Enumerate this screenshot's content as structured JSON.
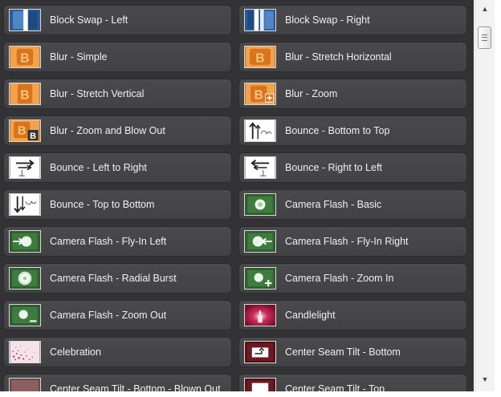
{
  "items": [
    {
      "label": "Block Swap - Left",
      "icon": "block-swap-left-icon"
    },
    {
      "label": "Block Swap - Right",
      "icon": "block-swap-right-icon"
    },
    {
      "label": "Blur - Simple",
      "icon": "blur-simple-icon"
    },
    {
      "label": "Blur - Stretch Horizontal",
      "icon": "blur-stretch-horizontal-icon"
    },
    {
      "label": "Blur - Stretch Vertical",
      "icon": "blur-stretch-vertical-icon"
    },
    {
      "label": "Blur - Zoom",
      "icon": "blur-zoom-icon"
    },
    {
      "label": "Blur - Zoom and Blow Out",
      "icon": "blur-zoom-blow-out-icon"
    },
    {
      "label": "Bounce - Bottom to Top",
      "icon": "bounce-bottom-to-top-icon"
    },
    {
      "label": "Bounce - Left to Right",
      "icon": "bounce-left-to-right-icon"
    },
    {
      "label": "Bounce - Right to Left",
      "icon": "bounce-right-to-left-icon"
    },
    {
      "label": "Bounce - Top to Bottom",
      "icon": "bounce-top-to-bottom-icon"
    },
    {
      "label": "Camera Flash - Basic",
      "icon": "camera-flash-basic-icon"
    },
    {
      "label": "Camera Flash - Fly-In Left",
      "icon": "camera-flash-fly-in-left-icon"
    },
    {
      "label": "Camera Flash - Fly-In Right",
      "icon": "camera-flash-fly-in-right-icon"
    },
    {
      "label": "Camera Flash - Radial Burst",
      "icon": "camera-flash-radial-burst-icon"
    },
    {
      "label": "Camera Flash - Zoom In",
      "icon": "camera-flash-zoom-in-icon"
    },
    {
      "label": "Camera Flash - Zoom Out",
      "icon": "camera-flash-zoom-out-icon"
    },
    {
      "label": "Candlelight",
      "icon": "candlelight-icon"
    },
    {
      "label": "Celebration",
      "icon": "celebration-icon"
    },
    {
      "label": "Center Seam Tilt - Bottom",
      "icon": "center-seam-tilt-bottom-icon"
    },
    {
      "label": "Center Seam Tilt - Bottom - Blown Out",
      "icon": "center-seam-tilt-bottom-blown-out-icon"
    },
    {
      "label": "Center Seam Tilt - Top",
      "icon": "center-seam-tilt-top-icon"
    }
  ],
  "colors": {
    "panel_bg": "#333335",
    "tile_bg": "#464649",
    "label_text": "#f0f0f0",
    "blur_orange": "#e08a2a",
    "flash_green": "#2e5e2e",
    "block_blue": "#2a5d9e",
    "candle_red": "#b01040"
  },
  "scrollbar": {
    "up_icon": "scroll-up-arrow-icon",
    "down_icon": "scroll-down-arrow-icon"
  }
}
